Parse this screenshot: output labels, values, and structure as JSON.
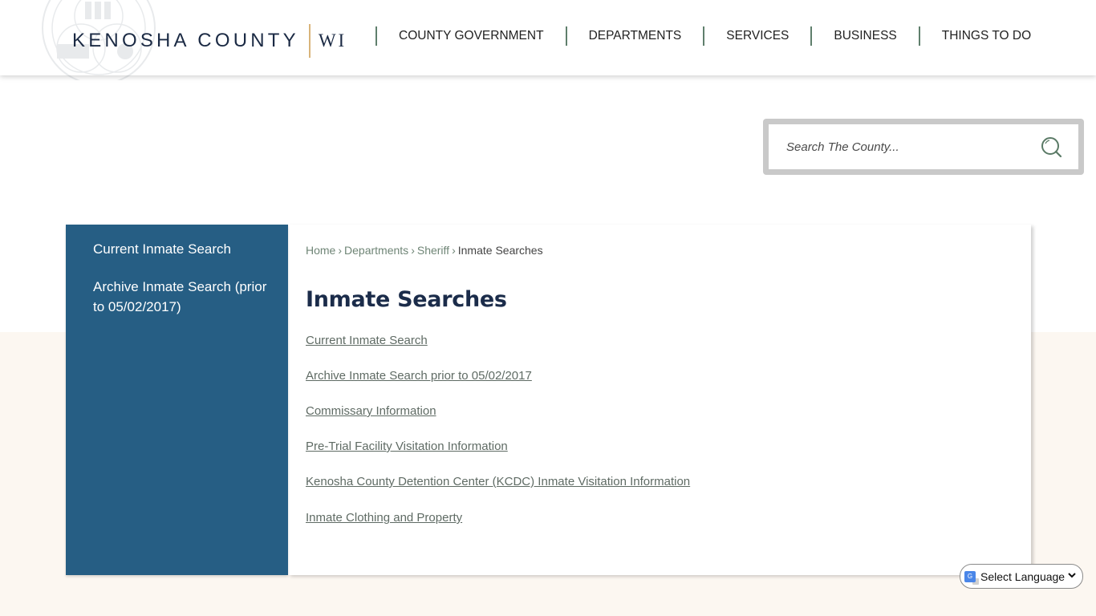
{
  "header": {
    "brand_name": "KENOSHA COUNTY",
    "brand_state": "WI",
    "nav": [
      {
        "label": "COUNTY GOVERNMENT"
      },
      {
        "label": "DEPARTMENTS"
      },
      {
        "label": "SERVICES"
      },
      {
        "label": "BUSINESS"
      },
      {
        "label": "THINGS TO DO"
      }
    ]
  },
  "search": {
    "placeholder": "Search The County...",
    "value": "",
    "icon": "search-icon"
  },
  "sidebar": {
    "items": [
      {
        "label": "Current Inmate Search"
      },
      {
        "label": "Archive Inmate Search (prior to 05/02/2017)"
      }
    ]
  },
  "breadcrumb": {
    "items": [
      {
        "label": "Home"
      },
      {
        "label": "Departments"
      },
      {
        "label": "Sheriff"
      }
    ],
    "separator": "›",
    "current": "Inmate Searches"
  },
  "main": {
    "title": "Inmate Searches",
    "links": [
      {
        "label": "Current Inmate Search"
      },
      {
        "label": "Archive Inmate Search prior to 05/02/2017"
      },
      {
        "label": "Commissary Information"
      },
      {
        "label": "Pre-Trial Facility Visitation Information"
      },
      {
        "label": "Kenosha County Detention Center (KCDC) Inmate Visitation Information"
      },
      {
        "label": "Inmate Clothing and Property"
      }
    ]
  },
  "language": {
    "label": "Select Language",
    "icon": "google-translate-icon"
  },
  "colors": {
    "sidebar_bg": "#265e84",
    "title": "#1b2c4a",
    "nav_divider": "#5f7f6c",
    "brand_divider": "#d9b47a",
    "beige_bg": "#fcf7f1",
    "link": "#5f6b64"
  }
}
